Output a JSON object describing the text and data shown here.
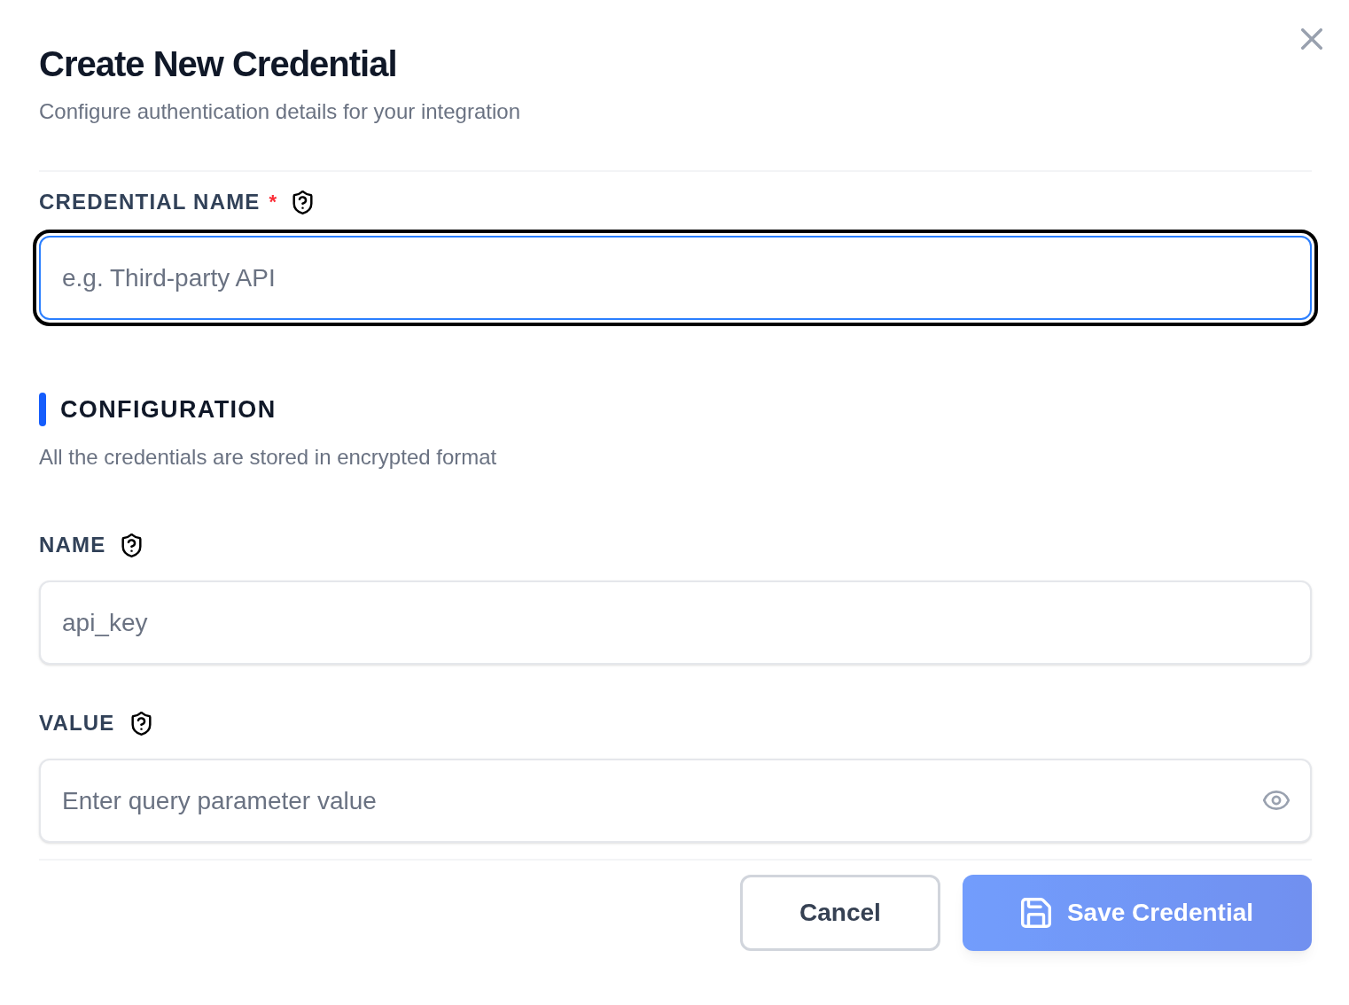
{
  "dialog": {
    "title": "Create New Credential",
    "subtitle": "Configure authentication details for your integration"
  },
  "credential_name": {
    "label": "CREDENTIAL NAME",
    "required_mark": "*",
    "placeholder": "e.g. Third-party API",
    "focused": true
  },
  "configuration": {
    "title": "CONFIGURATION",
    "description": "All the credentials are stored in encrypted format",
    "fields": [
      {
        "label": "NAME",
        "kind": "text",
        "value": "api_key",
        "focused": false
      },
      {
        "label": "VALUE",
        "kind": "secret",
        "placeholder": "Enter query parameter value",
        "focused": false
      }
    ]
  },
  "buttons": [
    {
      "label": "Cancel",
      "kind": "secondary",
      "disabled": false
    },
    {
      "label": "Save Credential",
      "kind": "primary",
      "disabled": true
    }
  ]
}
